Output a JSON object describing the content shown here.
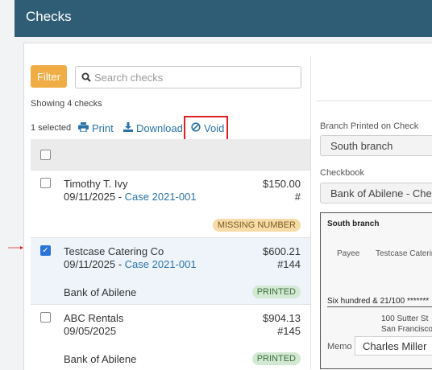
{
  "header": {
    "title": "Checks"
  },
  "toolbar": {
    "filter_label": "Filter",
    "search_placeholder": "Search checks"
  },
  "list": {
    "showing_text": "Showing 4 checks",
    "selected_text": "1 selected",
    "actions": {
      "print": "Print",
      "download": "Download",
      "void": "Void"
    }
  },
  "checks": [
    {
      "name": "Timothy T. Ivy",
      "date": "09/11/2025",
      "case_sep": " - ",
      "case": "Case 2021-001",
      "amount": "$150.00",
      "number": "#",
      "bank": "",
      "status": "MISSING NUMBER",
      "checked": false
    },
    {
      "name": "Testcase Catering Co",
      "date": "09/11/2025",
      "case_sep": " - ",
      "case": "Case 2021-001",
      "amount": "$600.21",
      "number": "#144",
      "bank": "Bank of Abilene",
      "status": "PRINTED",
      "checked": true
    },
    {
      "name": "ABC Rentals",
      "date": "09/05/2025",
      "case_sep": "",
      "case": "",
      "amount": "$904.13",
      "number": "#145",
      "bank": "Bank of Abilene",
      "status": "PRINTED",
      "checked": false
    }
  ],
  "details": {
    "branch_label": "Branch Printed on Check",
    "branch_value": "South branch",
    "checkbook_label": "Checkbook",
    "checkbook_value": "Bank of Abilene - Checkin",
    "preview": {
      "branch": "South branch",
      "payee_label": "Payee",
      "payee_value": "Testcase Caterin",
      "amount_words": "Six hundred & 21/100 *******",
      "address_line1": "100 Sutter St",
      "address_line2": "San Francisco,",
      "memo_label": "Memo",
      "memo_value": "Charles Miller"
    }
  },
  "colors": {
    "header_bg": "#2f5d75",
    "filter_bg": "#f0ad45",
    "link": "#2a73a8",
    "highlight": "#e02020"
  }
}
